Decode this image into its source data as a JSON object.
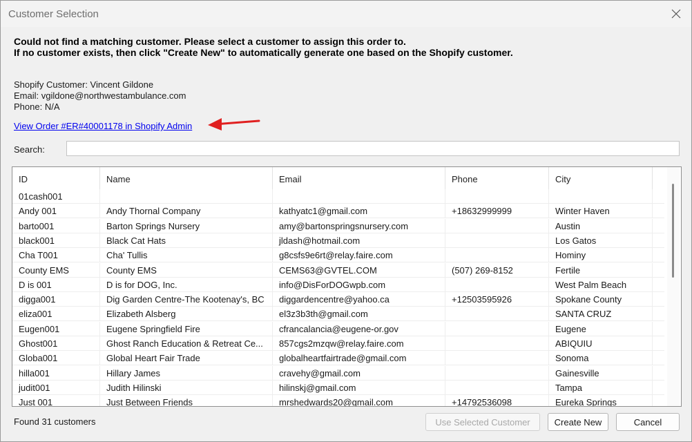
{
  "window": {
    "title": "Customer Selection"
  },
  "message": {
    "line1": "Could not find a matching customer. Please select a customer to assign this order to.",
    "line2": "If no customer exists, then click \"Create New\" to automatically generate one based on the Shopify customer."
  },
  "customer_info": {
    "name": "Shopify Customer: Vincent Gildone",
    "email": "Email: vgildone@northwestambulance.com",
    "phone": "Phone: N/A"
  },
  "order_link": "View Order #ER#40001178 in Shopify Admin",
  "search": {
    "label": "Search:",
    "value": ""
  },
  "table": {
    "columns": [
      "ID",
      "Name",
      "Email",
      "Phone",
      "City"
    ],
    "rows": [
      [
        "01cash001",
        "",
        "",
        "",
        ""
      ],
      [
        "Andy 001",
        "Andy Thornal Company",
        "kathyatc1@gmail.com",
        "+18632999999",
        "Winter Haven"
      ],
      [
        "barto001",
        "Barton Springs Nursery",
        "amy@bartonspringsnursery.com",
        "",
        "Austin"
      ],
      [
        "black001",
        "Black Cat Hats",
        "jldash@hotmail.com",
        "",
        "Los Gatos"
      ],
      [
        "Cha T001",
        "Cha' Tullis",
        "g8csfs9e6rt@relay.faire.com",
        "",
        "Hominy"
      ],
      [
        "County EMS",
        "County EMS",
        "CEMS63@GVTEL.COM",
        "(507) 269-8152",
        "Fertile"
      ],
      [
        "D is 001",
        "D is for DOG, Inc.",
        "info@DisForDOGwpb.com",
        "",
        "West Palm Beach"
      ],
      [
        "digga001",
        "Dig Garden Centre-The Kootenay's, BC",
        "diggardencentre@yahoo.ca",
        "+12503595926",
        "Spokane County"
      ],
      [
        "eliza001",
        "Elizabeth Alsberg",
        "el3z3b3th@gmail.com",
        "",
        "SANTA CRUZ"
      ],
      [
        "Eugen001",
        "Eugene Springfield Fire",
        "cfrancalancia@eugene-or.gov",
        "",
        "Eugene"
      ],
      [
        "Ghost001",
        "Ghost Ranch Education & Retreat Ce...",
        "857cgs2mzqw@relay.faire.com",
        "",
        "ABIQUIU"
      ],
      [
        "Globa001",
        "Global Heart Fair Trade",
        "globalheartfairtrade@gmail.com",
        "",
        "Sonoma"
      ],
      [
        "hilla001",
        "Hillary James",
        "cravehy@gmail.com",
        "",
        "Gainesville"
      ],
      [
        "judit001",
        "Judith Hilinski",
        "hilinskj@gmail.com",
        "",
        "Tampa"
      ],
      [
        "Just 001",
        "Just Between Friends",
        "mrshedwards20@gmail.com",
        "+14792536098",
        "Eureka Springs"
      ]
    ]
  },
  "footer": {
    "status": "Found 31 customers",
    "use_selected_label": "Use Selected Customer",
    "create_new_label": "Create New",
    "cancel_label": "Cancel"
  },
  "colors": {
    "link": "#0000ee",
    "arrow": "#e02020",
    "window_bg": "#f0f0f0"
  },
  "icons": {
    "close": "close-icon",
    "annotation": "red-arrow-icon"
  }
}
